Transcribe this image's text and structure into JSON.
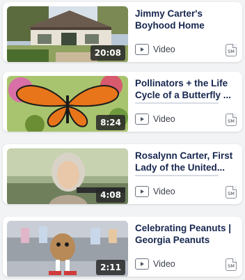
{
  "videos": [
    {
      "title": "Jimmy Carter's Boyhood Home",
      "duration": "20:08",
      "type_label": "Video",
      "badge": "SM"
    },
    {
      "title": "Pollinators + the Life Cycle of a Butterfly ...",
      "duration": "8:24",
      "type_label": "Video",
      "badge": "SM"
    },
    {
      "title": "Rosalynn Carter, First Lady of the United...",
      "duration": "4:08",
      "type_label": "Video",
      "badge": "SM"
    },
    {
      "title": "Celebrating Peanuts | Georgia Peanuts",
      "duration": "2:11",
      "type_label": "Video",
      "badge": "SM"
    }
  ],
  "icons": {
    "play": "play-icon",
    "badge": "sm-badge-icon"
  },
  "colors": {
    "title": "#16264f",
    "card_bg": "#ffffff",
    "page_bg": "#f2f3f5",
    "duration_bg": "#282828"
  }
}
